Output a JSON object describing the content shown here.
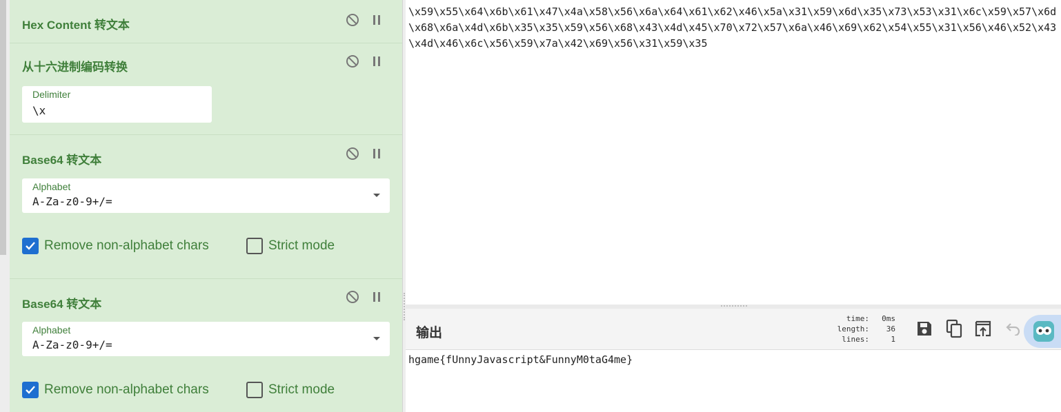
{
  "recipe": {
    "operations": [
      {
        "title": "Hex Content 转文本"
      },
      {
        "title": "从十六进制编码转换",
        "delimiter_label": "Delimiter",
        "delimiter_value": "\\x"
      },
      {
        "title": "Base64 转文本",
        "alphabet_label": "Alphabet",
        "alphabet_value": "A-Za-z0-9+/=",
        "remove_label": "Remove non-alphabet chars",
        "remove_checked": true,
        "strict_label": "Strict mode",
        "strict_checked": false
      },
      {
        "title": "Base64 转文本",
        "alphabet_label": "Alphabet",
        "alphabet_value": "A-Za-z0-9+/=",
        "remove_label": "Remove non-alphabet chars",
        "remove_checked": true,
        "strict_label": "Strict mode",
        "strict_checked": false
      }
    ],
    "icons": {
      "disable": "disable-icon",
      "pause": "pause-icon"
    }
  },
  "input": {
    "text": "\\x59\\x55\\x64\\x6b\\x61\\x47\\x4a\\x58\\x56\\x6a\\x64\\x61\\x62\\x46\\x5a\\x31\\x59\\x6d\\x35\\x73\\x53\\x31\\x6c\\x59\\x57\\x6d\\x68\\x6a\\x4d\\x6b\\x35\\x35\\x59\\x56\\x68\\x43\\x4d\\x45\\x70\\x72\\x57\\x6a\\x46\\x69\\x62\\x54\\x55\\x31\\x56\\x46\\x52\\x43\\x4d\\x46\\x6c\\x56\\x59\\x7a\\x42\\x69\\x56\\x31\\x59\\x35"
  },
  "output": {
    "title": "输出",
    "stats": {
      "time_label": "time:",
      "time_value": "0ms",
      "length_label": "length:",
      "length_value": "36",
      "lines_label": "lines:",
      "lines_value": "1"
    },
    "text": "hgame{fUnnyJavascript&FunnyM0taG4me}",
    "toolbar_icons": [
      "save-icon",
      "copy-icon",
      "replace-input-icon",
      "undo-icon"
    ]
  },
  "colors": {
    "recipe_bg": "#daedd6",
    "title_green": "#3f7f3a",
    "checkbox_blue": "#1e6fd0"
  }
}
